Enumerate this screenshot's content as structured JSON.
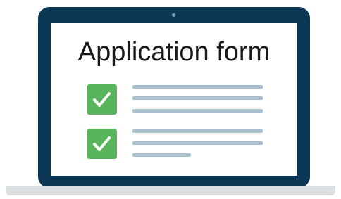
{
  "title": "Application form",
  "colors": {
    "bezel": "#0b3654",
    "screen": "#ffffff",
    "checkbox": "#58b55b",
    "text_lines": "#a7c1cf",
    "base": "#dcdfe2"
  },
  "icons": [
    "camera-dot-icon",
    "checkmark-icon",
    "checkmark-icon"
  ],
  "checklist": [
    {
      "checked": true,
      "text_lines": 3
    },
    {
      "checked": true,
      "text_lines": 3
    }
  ]
}
